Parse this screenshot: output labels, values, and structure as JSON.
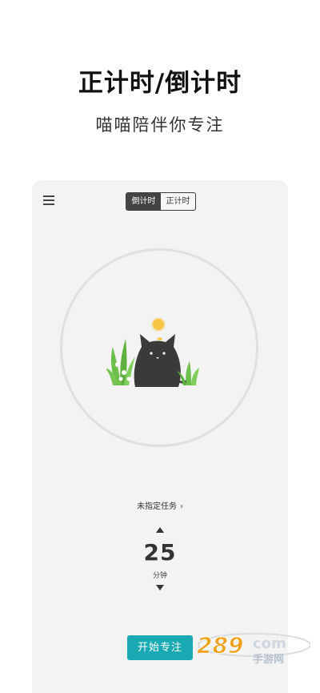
{
  "headline": "正计时/倒计时",
  "subline": "喵喵陪伴你专注",
  "app": {
    "mode_toggle": {
      "options": [
        "倒计时",
        "正计时"
      ],
      "selected": "倒计时"
    },
    "task": {
      "label": "未指定任务",
      "chevron": "›"
    },
    "timer": {
      "minutes": "25",
      "unit": "分钟"
    },
    "start_button": "开始专注"
  },
  "colors": {
    "accent": "#19a9b2",
    "toggle_active": "#444444",
    "card_bg": "#f3f3f3",
    "ring": "#e0e0e0",
    "cat": "#3a3a3a",
    "sun": "#f5c542",
    "leaf": "#6cc04a"
  },
  "icons": {
    "menu": "menu-icon",
    "cat": "cat-illustration",
    "up": "arrow-up-icon",
    "down": "arrow-down-icon"
  },
  "watermark": {
    "number": "289",
    "suffix": "com",
    "caption": "手游网"
  }
}
